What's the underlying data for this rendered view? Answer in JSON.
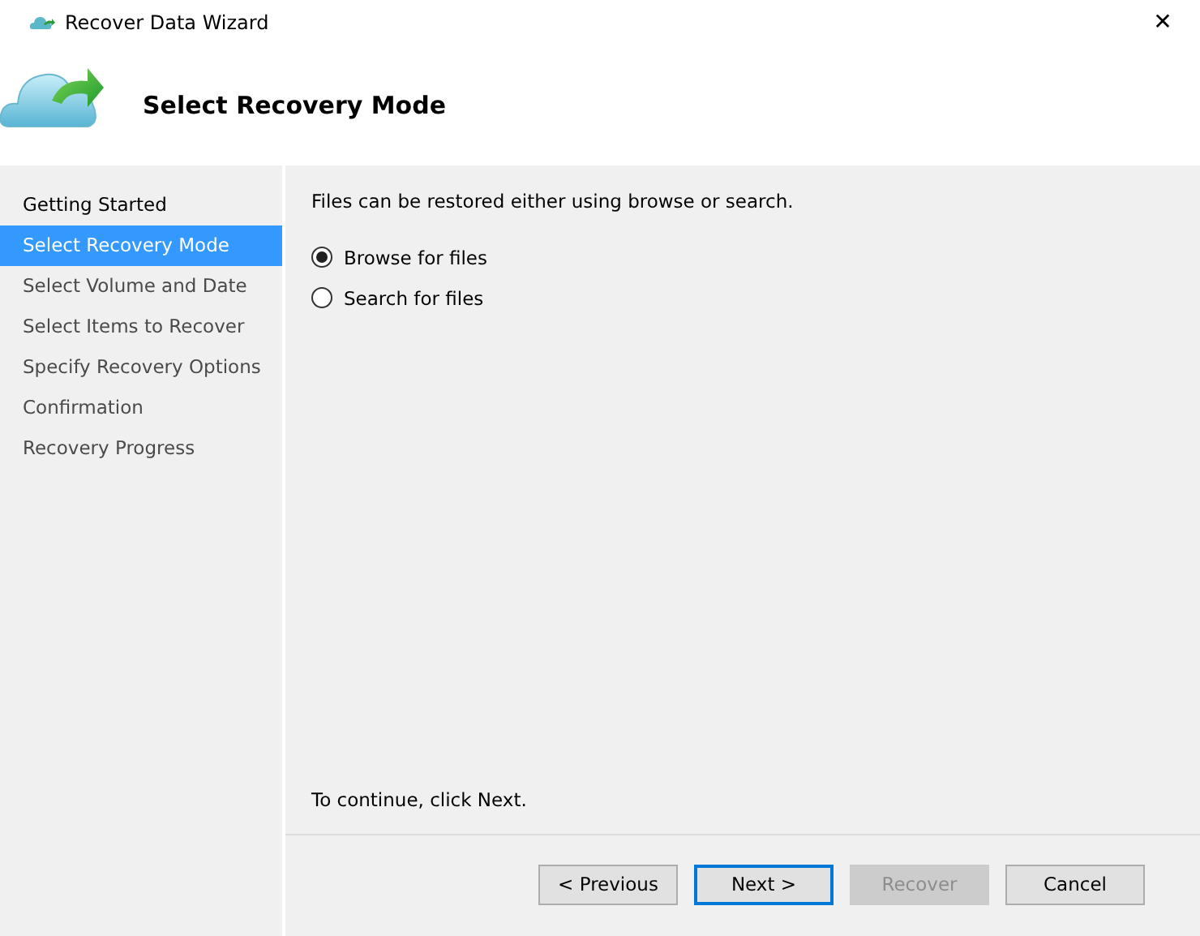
{
  "window": {
    "title": "Recover Data Wizard",
    "close": "✕"
  },
  "header": {
    "title": "Select Recovery Mode"
  },
  "sidebar": {
    "items": [
      {
        "label": "Getting Started",
        "selected": false
      },
      {
        "label": "Select Recovery Mode",
        "selected": true
      },
      {
        "label": "Select Volume and Date",
        "selected": false
      },
      {
        "label": "Select Items to Recover",
        "selected": false
      },
      {
        "label": "Specify Recovery Options",
        "selected": false
      },
      {
        "label": "Confirmation",
        "selected": false
      },
      {
        "label": "Recovery Progress",
        "selected": false
      }
    ]
  },
  "content": {
    "intro": "Files can be restored either using browse or search.",
    "options": [
      {
        "label": "Browse for files",
        "selected": true
      },
      {
        "label": "Search for files",
        "selected": false
      }
    ],
    "footer_note": "To continue, click Next."
  },
  "buttons": [
    {
      "label": "< Previous",
      "default": false,
      "disabled": false
    },
    {
      "label": "Next >",
      "default": true,
      "disabled": false
    },
    {
      "label": "Recover",
      "default": false,
      "disabled": true
    },
    {
      "label": "Cancel",
      "default": false,
      "disabled": false
    }
  ]
}
